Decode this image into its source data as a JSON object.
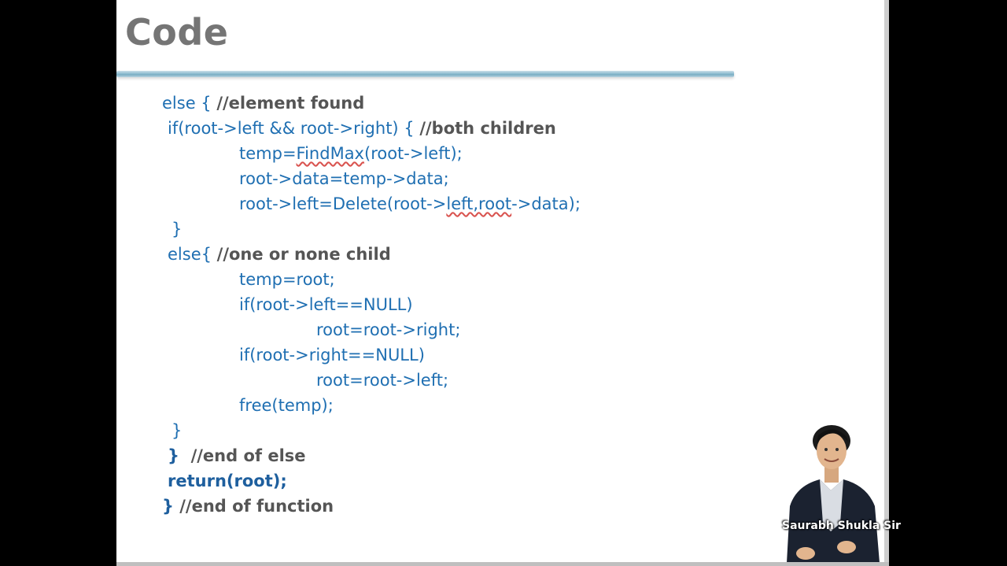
{
  "slide": {
    "title": "Code"
  },
  "code": {
    "line1_code": "else { ",
    "line1_comment": "//element found",
    "line2_code": "if(root->left && root->right) { ",
    "line2_comment": "//both children",
    "line3_a": "temp=",
    "line3_b": "FindMax",
    "line3_c": "(root->left);",
    "line4": "root->data=temp->data;",
    "line5_a": "root->left=Delete(root->",
    "line5_b": "left,root",
    "line5_c": "->data);",
    "line6": "}",
    "line7_code": "else{ ",
    "line7_comment": "//one or none child",
    "line8": "temp=root;",
    "line9": "if(root->left==NULL)",
    "line10": "root=root->right;",
    "line11": "if(root->right==NULL)",
    "line12": "root=root->left;",
    "line13": "free(temp);",
    "line14": "}",
    "line15_code": "}  ",
    "line15_comment": "//end of else",
    "line16": "return(root);",
    "line17_code": "} ",
    "line17_comment": "//end of function"
  },
  "presenter": {
    "name": "Saurabh Shukla Sir"
  }
}
